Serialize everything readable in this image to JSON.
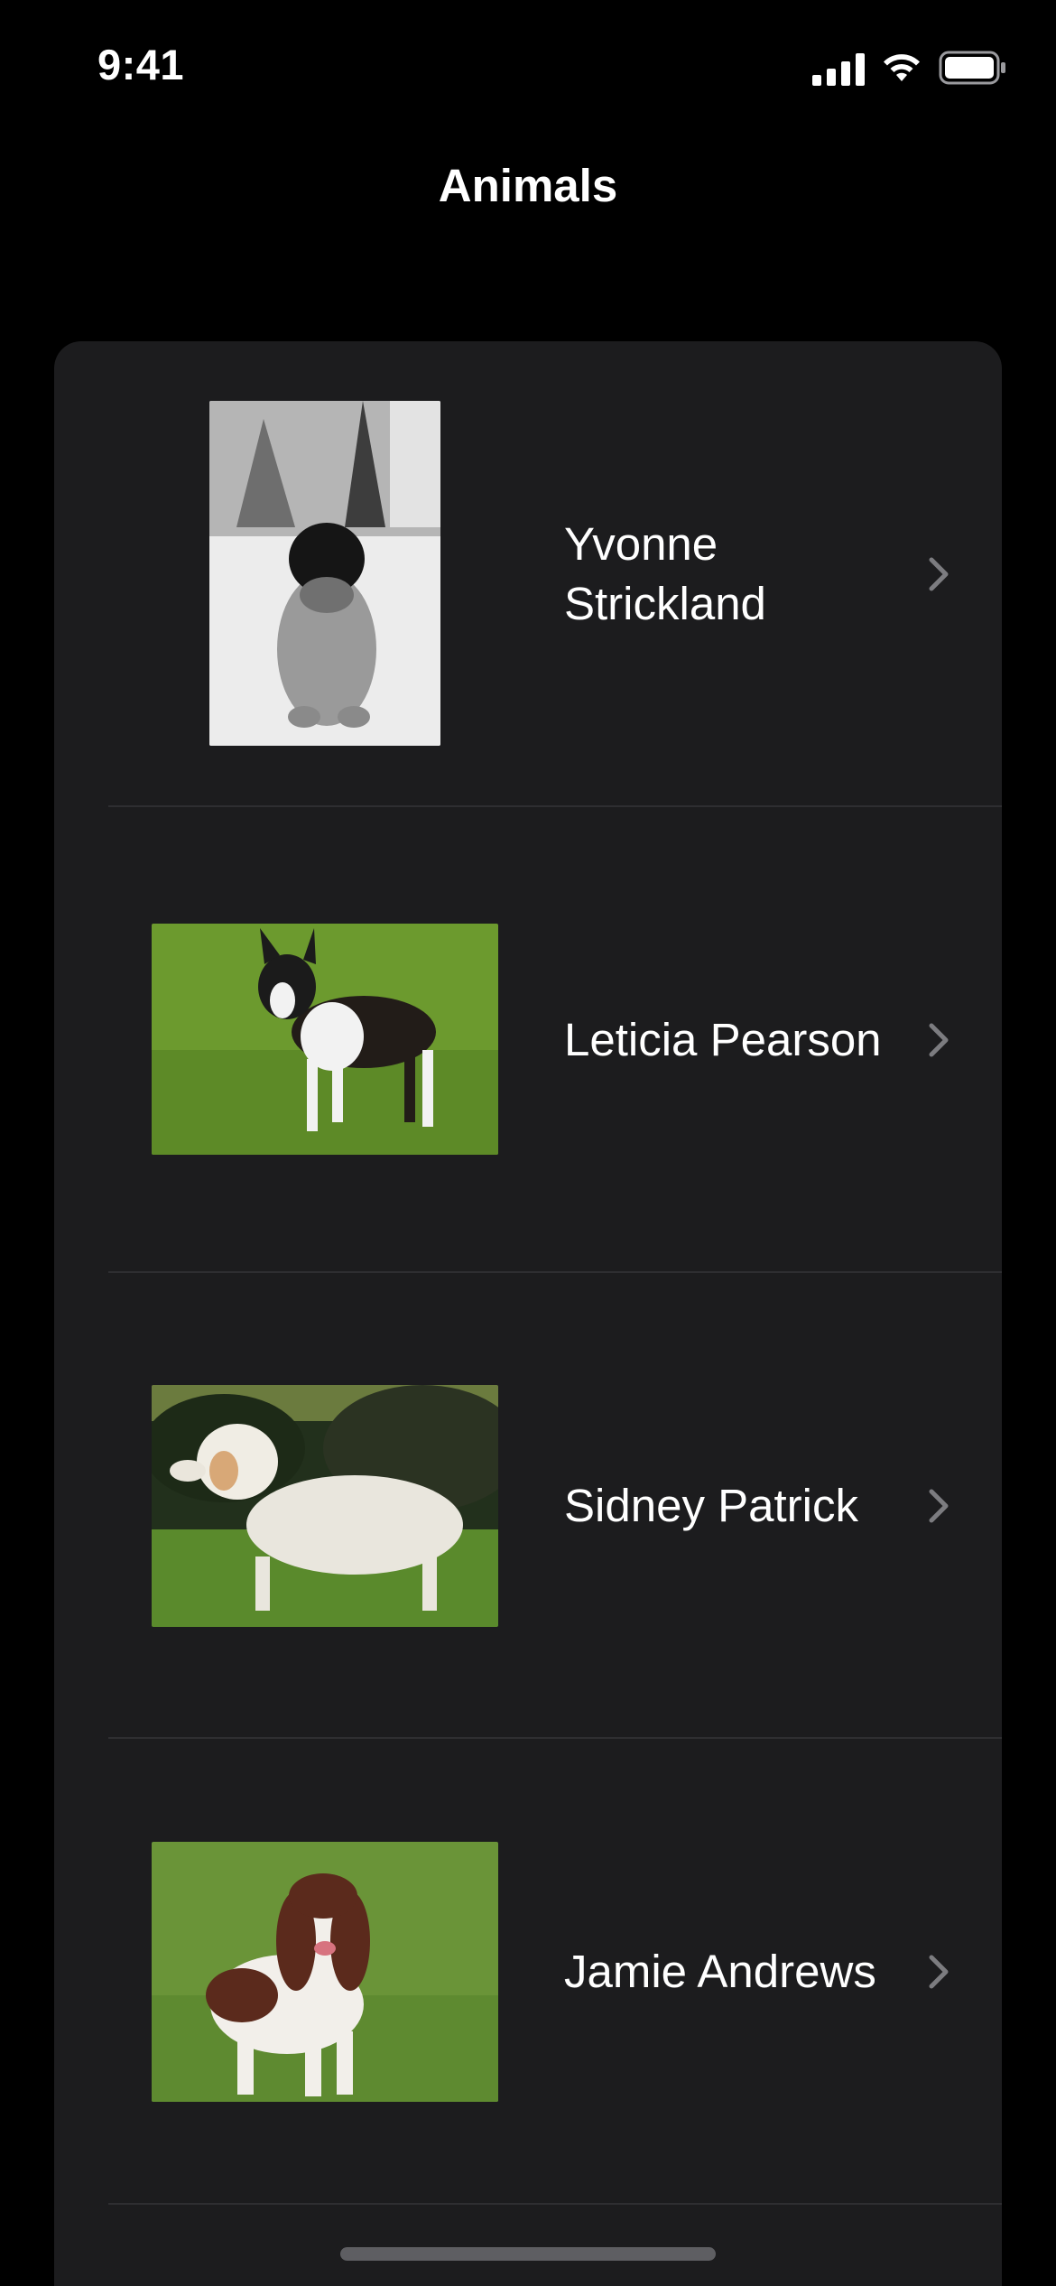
{
  "status_bar": {
    "time": "9:41"
  },
  "nav": {
    "title": "Animals"
  },
  "list": {
    "items": [
      {
        "name": "Yvonne Strickland",
        "image": "photo-white-black-dog-in-snow"
      },
      {
        "name": "Leticia Pearson",
        "image": "photo-boston-terrier-on-grass"
      },
      {
        "name": "Sidney Patrick",
        "image": "photo-clumber-spaniel-on-grass"
      },
      {
        "name": "Jamie Andrews",
        "image": "photo-springer-spaniel-on-grass"
      }
    ]
  },
  "colors": {
    "background": "#000000",
    "card": "#1c1c1e",
    "separator": "#2e2e31",
    "chevron": "#7c7c80",
    "text": "#ffffff"
  }
}
